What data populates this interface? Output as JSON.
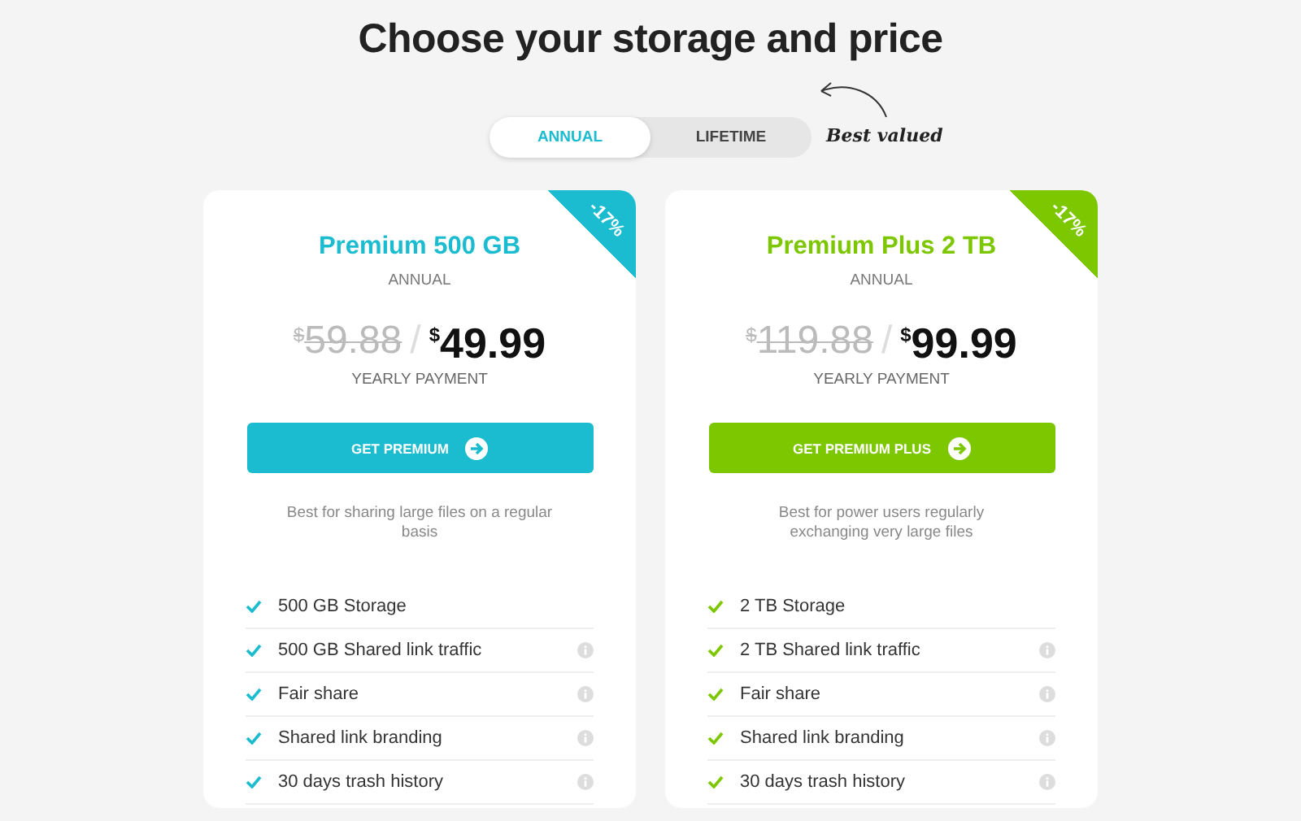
{
  "heading": "Choose your storage and price",
  "tabs": [
    {
      "label": "ANNUAL",
      "selected": true
    },
    {
      "label": "LIFETIME",
      "selected": false
    }
  ],
  "note": "Best valued",
  "plans": [
    {
      "name": "Premium 500 GB",
      "color": "#1bbcd0",
      "discount": "-17%",
      "period": "ANNUAL",
      "currency": "$",
      "old_price": "59.88",
      "separator": "/",
      "price": "49.99",
      "price_caption": "YEARLY PAYMENT",
      "button": "GET PREMIUM",
      "description": "Best for sharing large files on a regular basis",
      "features": [
        {
          "label": "500 GB Storage",
          "info": false
        },
        {
          "label": "500 GB Shared link traffic",
          "info": true
        },
        {
          "label": "Fair share",
          "info": true
        },
        {
          "label": "Shared link branding",
          "info": true
        },
        {
          "label": "30 days trash history",
          "info": true
        }
      ]
    },
    {
      "name": "Premium Plus 2 TB",
      "color": "#7dc700",
      "discount": "-17%",
      "period": "ANNUAL",
      "currency": "$",
      "old_price": "119.88",
      "separator": "/",
      "price": "99.99",
      "price_caption": "YEARLY PAYMENT",
      "button": "GET PREMIUM PLUS",
      "description": "Best for power users regularly exchanging very large files",
      "features": [
        {
          "label": "2 TB Storage",
          "info": false
        },
        {
          "label": "2 TB Shared link traffic",
          "info": true
        },
        {
          "label": "Fair share",
          "info": true
        },
        {
          "label": "Shared link branding",
          "info": true
        },
        {
          "label": "30 days trash history",
          "info": true
        }
      ]
    }
  ]
}
